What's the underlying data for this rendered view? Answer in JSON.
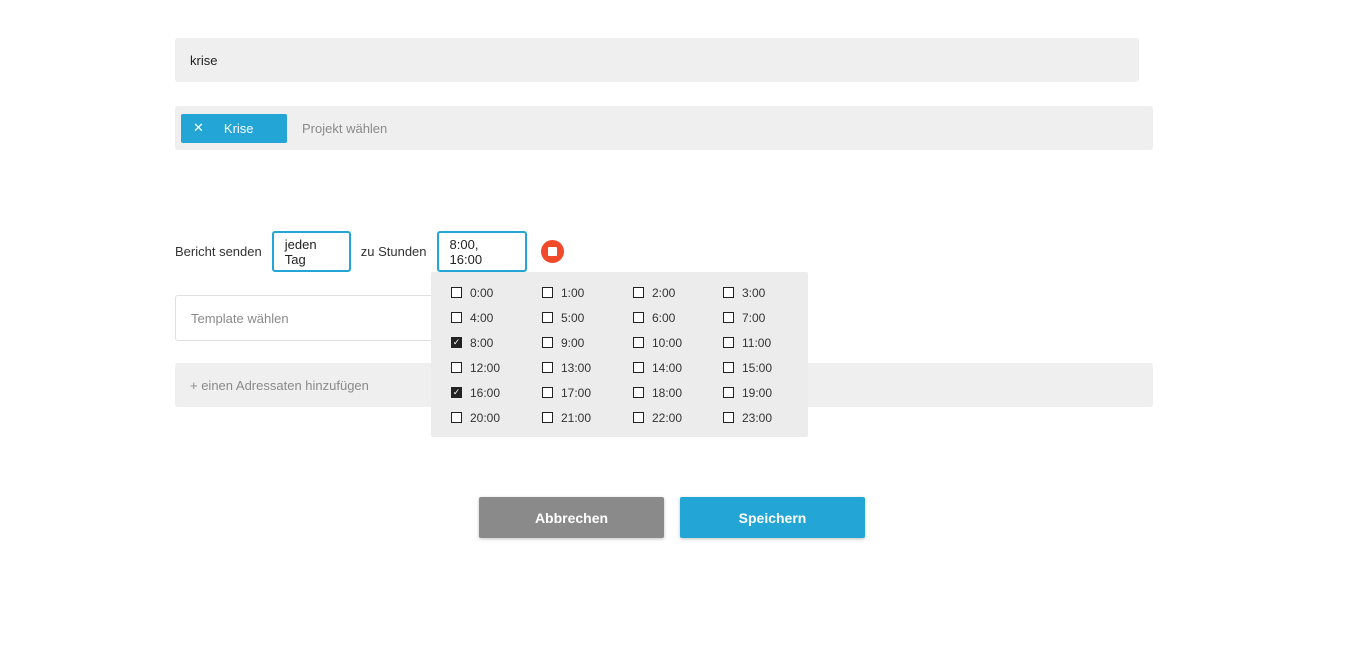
{
  "name_field": {
    "value": "krise"
  },
  "project": {
    "tag_label": "Krise",
    "tag_remove_icon": "✕",
    "placeholder": "Projekt wählen"
  },
  "report": {
    "send_label": "Bericht senden",
    "frequency": "jeden Tag",
    "hours_label": "zu Stunden",
    "hours_value": "8:00, 16:00"
  },
  "template": {
    "placeholder": "Template wählen"
  },
  "recipients": {
    "add_label": "+ einen Adressaten hinzufügen"
  },
  "hours_options": [
    {
      "label": "0:00",
      "checked": false
    },
    {
      "label": "1:00",
      "checked": false
    },
    {
      "label": "2:00",
      "checked": false
    },
    {
      "label": "3:00",
      "checked": false
    },
    {
      "label": "4:00",
      "checked": false
    },
    {
      "label": "5:00",
      "checked": false
    },
    {
      "label": "6:00",
      "checked": false
    },
    {
      "label": "7:00",
      "checked": false
    },
    {
      "label": "8:00",
      "checked": true
    },
    {
      "label": "9:00",
      "checked": false
    },
    {
      "label": "10:00",
      "checked": false
    },
    {
      "label": "11:00",
      "checked": false
    },
    {
      "label": "12:00",
      "checked": false
    },
    {
      "label": "13:00",
      "checked": false
    },
    {
      "label": "14:00",
      "checked": false
    },
    {
      "label": "15:00",
      "checked": false
    },
    {
      "label": "16:00",
      "checked": true
    },
    {
      "label": "17:00",
      "checked": false
    },
    {
      "label": "18:00",
      "checked": false
    },
    {
      "label": "19:00",
      "checked": false
    },
    {
      "label": "20:00",
      "checked": false
    },
    {
      "label": "21:00",
      "checked": false
    },
    {
      "label": "22:00",
      "checked": false
    },
    {
      "label": "23:00",
      "checked": false
    }
  ],
  "buttons": {
    "cancel": "Abbrechen",
    "save": "Speichern"
  },
  "colors": {
    "accent": "#23a6d6",
    "stop": "#f04a2a",
    "cancel": "#8a8a8a"
  }
}
